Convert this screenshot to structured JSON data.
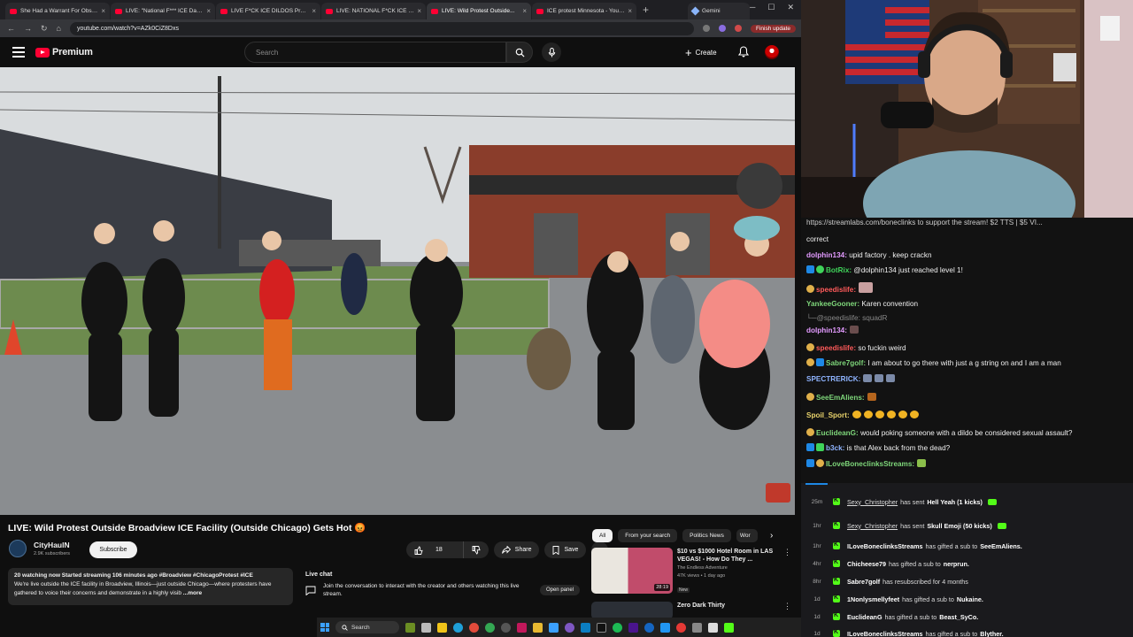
{
  "browser": {
    "tabs": [
      {
        "label": "She Had a Warrant For Obstru..."
      },
      {
        "label": "LIVE: \"National F*** ICE Day\" Pr..."
      },
      {
        "label": "LIVE F*CK ICE DILDOS Protest..."
      },
      {
        "label": "LIVE: NATIONAL F*CK ICE DAY"
      },
      {
        "label": "LIVE: Wild Protest Outside..."
      },
      {
        "label": "ICE protest Minnesota - YouTu..."
      },
      {
        "label": "Gemini"
      }
    ],
    "url": "youtube.com/watch?v=AZk0CiZ8Dxs",
    "finish_update": "Finish update"
  },
  "youtube": {
    "logo_text": "Premium",
    "search_placeholder": "Search",
    "create_label": "Create"
  },
  "video": {
    "title": "LIVE: Wild Protest Outside Broadview ICE Facility (Outside Chicago) Gets Hot 😡",
    "channel": "CityHaulN",
    "subscribers": "2.9K subscribers",
    "subscribe_label": "Subscribe",
    "likes": "18",
    "share_label": "Share",
    "save_label": "Save",
    "description_meta": "20 watching now  Started streaming 106 minutes ago  #Broadview #ChicagoProtest #ICE",
    "description_text": "We're live outside the ICE facility in Broadview, Illinois—just outside Chicago—where protesters have gathered to voice their concerns and demonstrate in a highly visib",
    "more_label": "...more"
  },
  "live_chat": {
    "heading": "Live chat",
    "text": "Join the conversation to interact with the creator and others watching this live stream.",
    "open_panel": "Open panel"
  },
  "recommendations": {
    "chips": [
      "All",
      "From your search",
      "Politics News",
      "Wor"
    ],
    "items": [
      {
        "title": "$10 vs $1000 Hotel Room in LAS VEGAS! - How Do They ...",
        "channel": "The Endless Adventure",
        "meta": "47K views • 1 day ago",
        "badge": "New",
        "duration": "28:19"
      },
      {
        "title": "Zero Dark Thirty",
        "channel": "",
        "meta": "",
        "badge": "",
        "duration": ""
      }
    ]
  },
  "stream_chat": {
    "top_banner": "https://streamlabs.com/boneclinks to support the stream! $2 TTS | $5 VI...",
    "messages": [
      {
        "user": "",
        "text": "correct",
        "color": "#ffffff"
      },
      {
        "user": "dolphin134:",
        "text": "upid factory . keep crackn",
        "color": "#e39bff"
      },
      {
        "user": "BotRix:",
        "text": "@dolphin134 just reached level 1!",
        "color": "#3fd35a"
      },
      {
        "user": "speedislife:",
        "text": "",
        "color": "#ff5a5a"
      },
      {
        "user": "YankeeGooner:",
        "text": "Karen convention",
        "color": "#7ed67a"
      },
      {
        "user": "@speedislife:",
        "text": "squadR",
        "color": "#888888"
      },
      {
        "user": "dolphin134:",
        "text": "",
        "color": "#e39bff"
      },
      {
        "user": "speedislife:",
        "text": "so fuckin weird",
        "color": "#ff5a5a"
      },
      {
        "user": "Sabre7golf:",
        "text": "I am about to go there with just a g string on and I am a man",
        "color": "#7ed67a"
      },
      {
        "user": "SPECTRERICK:",
        "text": "",
        "color": "#8fb4ff"
      },
      {
        "user": "SeeEmAliens:",
        "text": "",
        "color": "#7ed67a"
      },
      {
        "user": "Spoil_Sport:",
        "text": "",
        "color": "#e8d26b"
      },
      {
        "user": "EuclideanG:",
        "text": "would poking someone with a dildo be considered sexual assault?",
        "color": "#7ed67a"
      },
      {
        "user": "b3ck:",
        "text": "is that Alex back from the dead?",
        "color": "#8fb4ff"
      },
      {
        "user": "ILoveBoneclinksStreams:",
        "text": "",
        "color": "#7ed67a"
      }
    ]
  },
  "events": [
    {
      "time": "25m",
      "user": "Sexy_Christopher",
      "action": "has sent",
      "detail": "Hell Yeah (1 kicks)"
    },
    {
      "time": "1hr",
      "user": "Sexy_Christopher",
      "action": "has sent",
      "detail": "Skull Emoji (50 kicks)"
    },
    {
      "time": "1hr",
      "user": "ILoveBoneclinksStreams",
      "action": "has gifted a sub to",
      "detail": "SeeEmAliens."
    },
    {
      "time": "4hr",
      "user": "Chicheese79",
      "action": "has gifted a sub to",
      "detail": "nerprun."
    },
    {
      "time": "8hr",
      "user": "Sabre7golf",
      "action": "has resubscribed for 4 months",
      "detail": ""
    },
    {
      "time": "1d",
      "user": "1Nonlysmellyfeet",
      "action": "has gifted a sub to",
      "detail": "Nukaine."
    },
    {
      "time": "1d",
      "user": "EuclideanG",
      "action": "has gifted a sub to",
      "detail": "Beast_SyCo."
    },
    {
      "time": "1d",
      "user": "ILoveBoneclinksStreams",
      "action": "has gifted a sub to",
      "detail": "Blyther."
    }
  ],
  "taskbar": {
    "search_label": "Search"
  },
  "colors": {
    "youtube_red": "#ff0033",
    "kick_green": "#53fc18",
    "bg": "#0f0f0f"
  }
}
